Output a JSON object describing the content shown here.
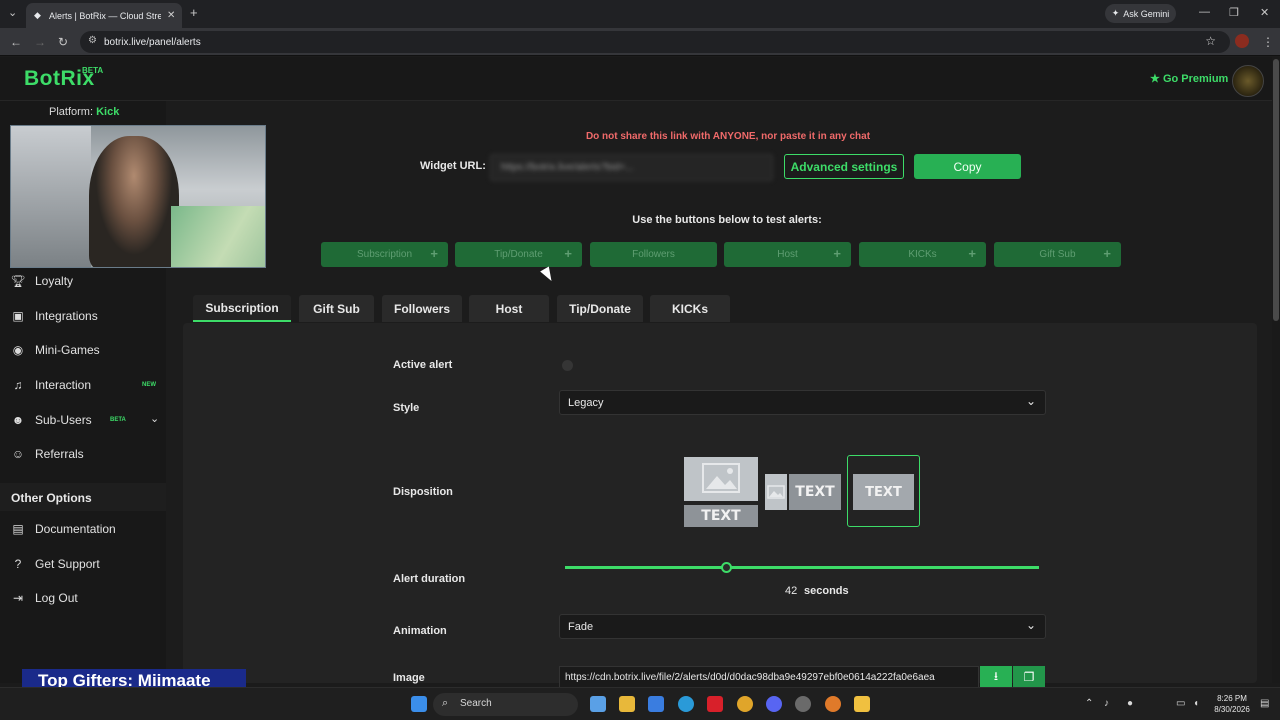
{
  "browser": {
    "tab_title": "Alerts | BotRix — Cloud Streaming",
    "url": "botrix.live/panel/alerts",
    "ask_gemini": "Ask Gemini"
  },
  "header": {
    "logo": "BotRix",
    "logo_badge": "BETA",
    "go_premium": "Go Premium"
  },
  "sidebar": {
    "platform_label": "Platform:",
    "platform_value": "Kick",
    "items": [
      {
        "label": "Loyalty",
        "icon": "trophy-icon"
      },
      {
        "label": "Integrations",
        "icon": "plug-icon"
      },
      {
        "label": "Mini-Games",
        "icon": "gamepad-icon"
      },
      {
        "label": "Interaction",
        "icon": "music-note-icon",
        "badge": "NEW"
      },
      {
        "label": "Sub-Users",
        "icon": "users-icon",
        "badge": "BETA"
      },
      {
        "label": "Referrals",
        "icon": "people-icon"
      }
    ],
    "other_options_title": "Other Options",
    "other_items": [
      {
        "label": "Documentation",
        "icon": "document-icon"
      },
      {
        "label": "Get Support",
        "icon": "question-icon"
      },
      {
        "label": "Log Out",
        "icon": "logout-icon"
      }
    ]
  },
  "overlay": {
    "top_gifters": "Top Gifters: Miimaate"
  },
  "widget": {
    "warning": "Do not share this link with ANYONE, nor paste it in any chat",
    "url_label": "Widget URL:",
    "url_value": "https://botrix.live/alerts?bid=...",
    "advanced_settings": "Advanced settings",
    "copy": "Copy"
  },
  "test_alerts": {
    "heading": "Use the buttons below to test alerts:",
    "buttons": [
      "Subscription",
      "Tip/Donate",
      "Followers",
      "Host",
      "KICKs",
      "Gift Sub"
    ]
  },
  "tabs": [
    "Subscription",
    "Gift Sub",
    "Followers",
    "Host",
    "Tip/Donate",
    "KICKs"
  ],
  "form": {
    "active_alert_label": "Active alert",
    "style_label": "Style",
    "style_value": "Legacy",
    "disposition_label": "Disposition",
    "disposition_text": "TEXT",
    "alert_duration_label": "Alert duration",
    "alert_duration_value": "42",
    "alert_duration_unit": "seconds",
    "alert_duration_fraction": 0.34,
    "animation_label": "Animation",
    "animation_value": "Fade",
    "image_label": "Image",
    "image_url": "https://cdn.botrix.live/file/2/alerts/d0d/d0dac98dba9e49297ebf0e0614a222fa0e6aea"
  },
  "taskbar": {
    "search": "Search",
    "time": "8:26 PM",
    "date": "8/30/2026"
  }
}
